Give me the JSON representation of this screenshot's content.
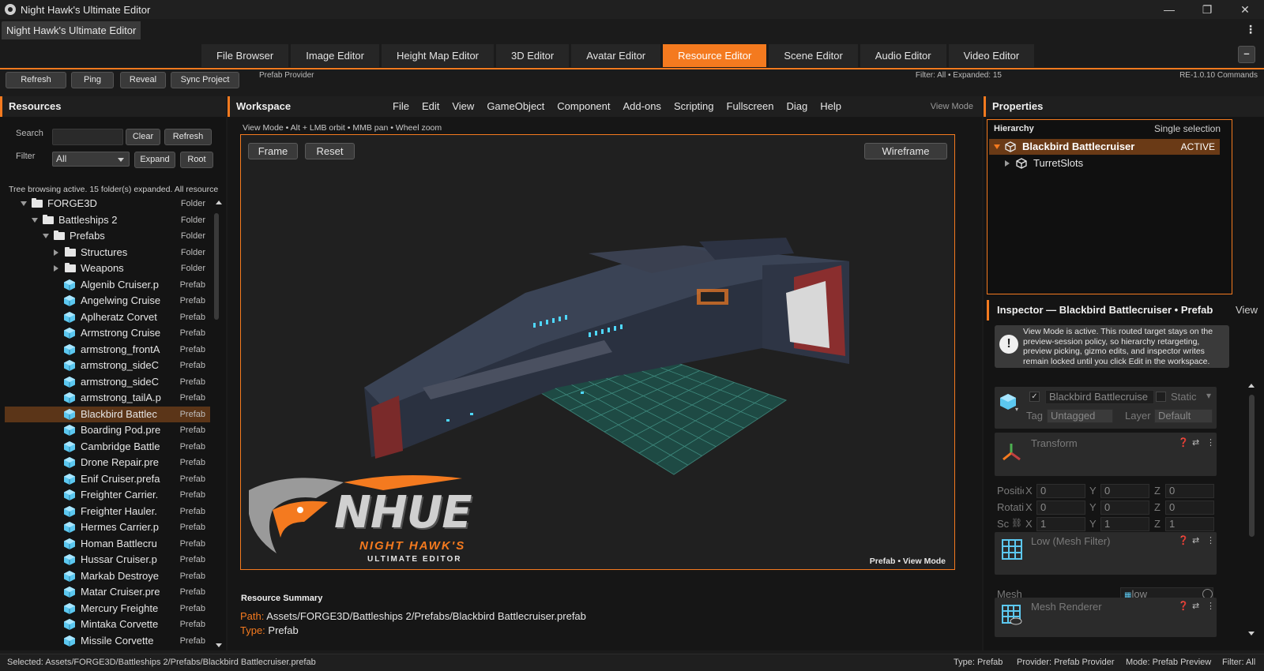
{
  "window": {
    "title": "Night Hawk's Ultimate Editor",
    "minimize": "—",
    "restore": "❐",
    "close": "✕"
  },
  "app_tab": "Night Hawk's Ultimate Editor",
  "editor_tabs": [
    "File Browser",
    "Image Editor",
    "Height Map Editor",
    "3D Editor",
    "Avatar Editor",
    "Resource Editor",
    "Scene Editor",
    "Audio Editor",
    "Video Editor"
  ],
  "active_editor_tab": "Resource Editor",
  "collapse_button": "–",
  "toolbar": {
    "buttons": [
      "Refresh",
      "Ping",
      "Reveal",
      "Sync Project"
    ],
    "provider": "Prefab Provider",
    "filter_status": "Filter: All • Expanded: 15",
    "commands": "RE-1.0.10 Commands"
  },
  "resources": {
    "title": "Resources",
    "search_label": "Search",
    "search_value": "",
    "clear": "Clear",
    "refresh": "Refresh",
    "filter_label": "Filter",
    "filter_value": "All",
    "expand": "Expand",
    "root": "Root",
    "status": "Tree browsing active. 15 folder(s) expanded. All resource",
    "tree": [
      {
        "label": "FORGE3D",
        "type": "Folder",
        "depth": 0,
        "kind": "folder",
        "arrow": "down"
      },
      {
        "label": "Battleships 2",
        "type": "Folder",
        "depth": 1,
        "kind": "folder",
        "arrow": "down"
      },
      {
        "label": "Prefabs",
        "type": "Folder",
        "depth": 2,
        "kind": "folder",
        "arrow": "down"
      },
      {
        "label": "Structures",
        "type": "Folder",
        "depth": 3,
        "kind": "folder",
        "arrow": "right"
      },
      {
        "label": "Weapons",
        "type": "Folder",
        "depth": 3,
        "kind": "folder",
        "arrow": "right"
      },
      {
        "label": "Algenib Cruiser.p",
        "type": "Prefab",
        "depth": 3,
        "kind": "prefab"
      },
      {
        "label": "Angelwing Cruise",
        "type": "Prefab",
        "depth": 3,
        "kind": "prefab"
      },
      {
        "label": "Aplheratz Corvet",
        "type": "Prefab",
        "depth": 3,
        "kind": "prefab"
      },
      {
        "label": "Armstrong Cruise",
        "type": "Prefab",
        "depth": 3,
        "kind": "prefab"
      },
      {
        "label": "armstrong_frontA",
        "type": "Prefab",
        "depth": 3,
        "kind": "prefab"
      },
      {
        "label": "armstrong_sideC",
        "type": "Prefab",
        "depth": 3,
        "kind": "prefab"
      },
      {
        "label": "armstrong_sideC",
        "type": "Prefab",
        "depth": 3,
        "kind": "prefab"
      },
      {
        "label": "armstrong_tailA.p",
        "type": "Prefab",
        "depth": 3,
        "kind": "prefab"
      },
      {
        "label": "Blackbird Battlec",
        "type": "Prefab",
        "depth": 3,
        "kind": "prefab",
        "selected": true
      },
      {
        "label": "Boarding Pod.pre",
        "type": "Prefab",
        "depth": 3,
        "kind": "prefab"
      },
      {
        "label": "Cambridge Battle",
        "type": "Prefab",
        "depth": 3,
        "kind": "prefab"
      },
      {
        "label": "Drone Repair.pre",
        "type": "Prefab",
        "depth": 3,
        "kind": "prefab"
      },
      {
        "label": "Enif Cruiser.prefa",
        "type": "Prefab",
        "depth": 3,
        "kind": "prefab"
      },
      {
        "label": "Freighter Carrier.",
        "type": "Prefab",
        "depth": 3,
        "kind": "prefab"
      },
      {
        "label": "Freighter Hauler.",
        "type": "Prefab",
        "depth": 3,
        "kind": "prefab"
      },
      {
        "label": "Hermes Carrier.p",
        "type": "Prefab",
        "depth": 3,
        "kind": "prefab"
      },
      {
        "label": "Homan Battlecru",
        "type": "Prefab",
        "depth": 3,
        "kind": "prefab"
      },
      {
        "label": "Hussar Cruiser.p",
        "type": "Prefab",
        "depth": 3,
        "kind": "prefab"
      },
      {
        "label": "Markab Destroye",
        "type": "Prefab",
        "depth": 3,
        "kind": "prefab"
      },
      {
        "label": "Matar Cruiser.pre",
        "type": "Prefab",
        "depth": 3,
        "kind": "prefab"
      },
      {
        "label": "Mercury Freighte",
        "type": "Prefab",
        "depth": 3,
        "kind": "prefab"
      },
      {
        "label": "Mintaka Corvette",
        "type": "Prefab",
        "depth": 3,
        "kind": "prefab"
      },
      {
        "label": "Missile Corvette",
        "type": "Prefab",
        "depth": 3,
        "kind": "prefab"
      }
    ]
  },
  "workspace": {
    "title": "Workspace",
    "menu": [
      "File",
      "Edit",
      "View",
      "GameObject",
      "Component",
      "Add-ons",
      "Scripting",
      "Fullscreen",
      "Diag",
      "Help"
    ],
    "view_mode": "View Mode",
    "hint": "View Mode  •  Alt + LMB orbit  •  MMB pan  •  Wheel zoom",
    "frame": "Frame",
    "reset": "Reset",
    "wireframe": "Wireframe",
    "logo": {
      "big": "NHUE",
      "line1": "NIGHT HAWK'S",
      "line2": "ULTIMATE EDITOR"
    },
    "viewport_status": "Prefab  •  View Mode",
    "summary_title": "Resource Summary",
    "path_label": "Path:",
    "path_value": "Assets/FORGE3D/Battleships 2/Prefabs/Blackbird Battlecruiser.prefab",
    "type_label": "Type:",
    "type_value": "Prefab"
  },
  "properties": {
    "title": "Properties",
    "hierarchy_title": "Hierarchy",
    "selection_mode": "Single selection",
    "hierarchy": [
      {
        "label": "Blackbird Battlecruiser",
        "badge": "ACTIVE",
        "selected": true,
        "arrow": "down"
      },
      {
        "label": "TurretSlots",
        "badge": "",
        "selected": false,
        "arrow": "right"
      }
    ],
    "inspector_title": "Inspector — Blackbird Battlecruiser • Prefab",
    "inspector_view": "View",
    "notice": "View Mode is active. This routed target stays on the preview-session policy, so hierarchy retargeting, preview picking, gizmo edits, and inspector writes remain locked until you click Edit in the workspace.",
    "object_name": "Blackbird Battlecruise",
    "static_label": "Static",
    "tag_label": "Tag",
    "tag_value": "Untagged",
    "layer_label": "Layer",
    "layer_value": "Default",
    "transform_title": "Transform",
    "position_label": "Positic",
    "rotation_label": "Rotati",
    "scale_label": "Sc",
    "axes": [
      "X",
      "Y",
      "Z"
    ],
    "position": [
      "0",
      "0",
      "0"
    ],
    "rotation": [
      "0",
      "0",
      "0"
    ],
    "scale": [
      "1",
      "1",
      "1"
    ],
    "mesh_filter_title": "Low (Mesh Filter)",
    "mesh_label": "Mesh",
    "mesh_value": "low",
    "mesh_renderer_title": "Mesh Renderer"
  },
  "statusbar": {
    "selected": "Selected: Assets/FORGE3D/Battleships 2/Prefabs/Blackbird Battlecruiser.prefab",
    "type": "Type: Prefab",
    "provider": "Provider: Prefab Provider",
    "mode": "Mode: Prefab Preview",
    "filter": "Filter: All"
  },
  "colors": {
    "accent": "#f47a1f",
    "selection": "#5b3518",
    "prefab_icon": "#5cc8f0"
  }
}
